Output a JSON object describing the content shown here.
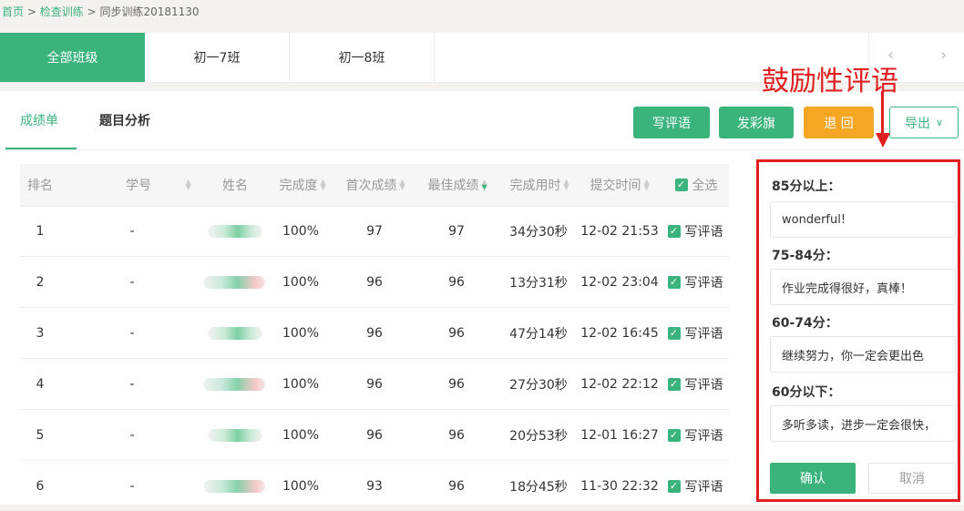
{
  "breadcrumb": {
    "home": "首页",
    "sep": ">",
    "middle": "检查训练",
    "current": "同步训练20181130"
  },
  "class_tabs": [
    "全部班级",
    "初一7班",
    "初一8班"
  ],
  "nav_arrows": {
    "prev": "‹",
    "next": "›"
  },
  "sub_tabs": [
    "成绩单",
    "题目分析"
  ],
  "toolbar": {
    "write_comment": "写评语",
    "send_flag": "发彩旗",
    "return": "退 回",
    "export": "导出",
    "export_caret": "∨"
  },
  "annotation": "鼓励性评语",
  "table": {
    "headers": [
      "排名",
      "学号",
      "姓名",
      "完成度",
      "首次成绩",
      "最佳成绩",
      "完成用时",
      "提交时间",
      "全选"
    ],
    "rows": [
      {
        "rank": "1",
        "id": "-",
        "completion": "100%",
        "first": "97",
        "best": "97",
        "duration": "34分30秒",
        "submitted": "12-02 21:53",
        "action": "写评语"
      },
      {
        "rank": "2",
        "id": "-",
        "completion": "100%",
        "first": "96",
        "best": "96",
        "duration": "13分31秒",
        "submitted": "12-02 23:04",
        "action": "写评语"
      },
      {
        "rank": "3",
        "id": "-",
        "completion": "100%",
        "first": "96",
        "best": "96",
        "duration": "47分14秒",
        "submitted": "12-02 16:45",
        "action": "写评语"
      },
      {
        "rank": "4",
        "id": "-",
        "completion": "100%",
        "first": "96",
        "best": "96",
        "duration": "27分30秒",
        "submitted": "12-02 22:12",
        "action": "写评语"
      },
      {
        "rank": "5",
        "id": "-",
        "completion": "100%",
        "first": "96",
        "best": "96",
        "duration": "20分53秒",
        "submitted": "12-01 16:27",
        "action": "写评语"
      },
      {
        "rank": "6",
        "id": "-",
        "completion": "100%",
        "first": "93",
        "best": "96",
        "duration": "18分45秒",
        "submitted": "11-30 22:32",
        "action": "写评语"
      }
    ]
  },
  "comment_panel": {
    "groups": [
      {
        "label": "85分以上：",
        "text": "wonderful!"
      },
      {
        "label": "75-84分：",
        "text": "作业完成得很好，真棒！"
      },
      {
        "label": "60-74分：",
        "text": "继续努力，你一定会更出色"
      },
      {
        "label": "60分以下：",
        "text": "多听多读，进步一定会很快，"
      }
    ],
    "confirm": "确认",
    "cancel": "取消"
  },
  "colors": {
    "accent": "#3bb37d",
    "orange": "#f5a623",
    "annotation": "#e02020"
  }
}
